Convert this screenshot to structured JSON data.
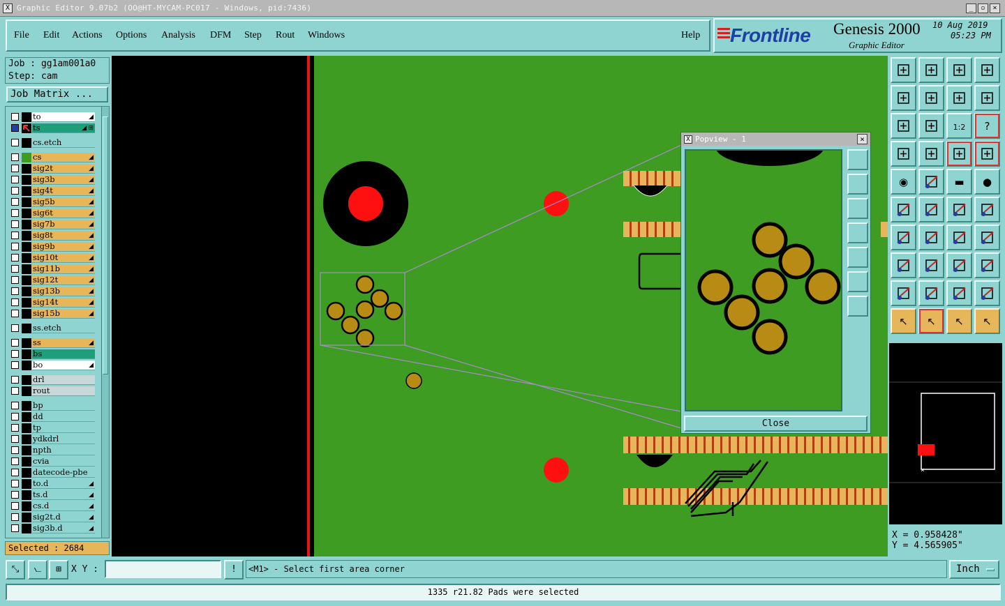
{
  "window": {
    "title": "Graphic Editor 9.07b2 (OO@HT-MYCAM-PC017 - Windows, pid:7436)",
    "title_icon": "X",
    "min_icon": "minimize-icon",
    "restore_icon": "restore-icon",
    "close_icon": "close-icon"
  },
  "menu": {
    "items": [
      "File",
      "Edit",
      "Actions",
      "Options",
      "Analysis",
      "DFM",
      "Step",
      "Rout",
      "Windows"
    ],
    "help": "Help"
  },
  "brand": {
    "logo": "Frontline",
    "product": "Genesis 2000",
    "subtitle": "Graphic Editor",
    "date": "10 Aug 2019",
    "time": "05:23 PM"
  },
  "job": {
    "job_line": "Job : gg1am001a0",
    "step_line": "Step: cam",
    "matrix_button": "Job Matrix ..."
  },
  "layers": [
    {
      "name": "to",
      "bg": "#ffffff",
      "color": "#000000",
      "mark": "◢"
    },
    {
      "name": "ts",
      "bg": "#1f9e7a",
      "color": "#000000",
      "mark": "◢ ⊞",
      "active": true
    },
    {
      "name": "cs.etch",
      "bg": "#8fd4d0",
      "color": "#000000",
      "mark": ""
    },
    {
      "name": "cs",
      "bg": "#e8b65a",
      "color": "#3f9c22",
      "mark": "◢"
    },
    {
      "name": "sig2t",
      "bg": "#e8b65a",
      "color": "#000000",
      "mark": "◢"
    },
    {
      "name": "sig3b",
      "bg": "#e8b65a",
      "color": "#000000",
      "mark": "◢"
    },
    {
      "name": "sig4t",
      "bg": "#e8b65a",
      "color": "#000000",
      "mark": "◢"
    },
    {
      "name": "sig5b",
      "bg": "#e8b65a",
      "color": "#000000",
      "mark": "◢"
    },
    {
      "name": "sig6t",
      "bg": "#e8b65a",
      "color": "#000000",
      "mark": "◢"
    },
    {
      "name": "sig7b",
      "bg": "#e8b65a",
      "color": "#000000",
      "mark": "◢"
    },
    {
      "name": "sig8t",
      "bg": "#e8b65a",
      "color": "#000000",
      "mark": "◢"
    },
    {
      "name": "sig9b",
      "bg": "#e8b65a",
      "color": "#000000",
      "mark": "◢"
    },
    {
      "name": "sig10t",
      "bg": "#e8b65a",
      "color": "#000000",
      "mark": "◢"
    },
    {
      "name": "sig11b",
      "bg": "#e8b65a",
      "color": "#000000",
      "mark": "◢"
    },
    {
      "name": "sig12t",
      "bg": "#e8b65a",
      "color": "#000000",
      "mark": "◢"
    },
    {
      "name": "sig13b",
      "bg": "#e8b65a",
      "color": "#000000",
      "mark": "◢"
    },
    {
      "name": "sig14t",
      "bg": "#e8b65a",
      "color": "#000000",
      "mark": "◢"
    },
    {
      "name": "sig15b",
      "bg": "#e8b65a",
      "color": "#000000",
      "mark": "◢"
    },
    {
      "name": "ss.etch",
      "bg": "#8fd4d0",
      "color": "#000000",
      "mark": ""
    },
    {
      "name": "ss",
      "bg": "#e8b65a",
      "color": "#000000",
      "mark": "◢"
    },
    {
      "name": "bs",
      "bg": "#1f9e7a",
      "color": "#000000",
      "mark": ""
    },
    {
      "name": "bo",
      "bg": "#ffffff",
      "color": "#000000",
      "mark": "◢"
    },
    {
      "name": "drl",
      "bg": "#c8d8d8",
      "color": "#000000",
      "mark": ""
    },
    {
      "name": "rout",
      "bg": "#c8d8d8",
      "color": "#000000",
      "mark": ""
    },
    {
      "name": "bp",
      "bg": "#8fd4d0",
      "color": "#000000",
      "mark": ""
    },
    {
      "name": "dd",
      "bg": "#8fd4d0",
      "color": "#000000",
      "mark": ""
    },
    {
      "name": "tp",
      "bg": "#8fd4d0",
      "color": "#000000",
      "mark": ""
    },
    {
      "name": "ydkdrl",
      "bg": "#8fd4d0",
      "color": "#000000",
      "mark": ""
    },
    {
      "name": "npth",
      "bg": "#8fd4d0",
      "color": "#000000",
      "mark": ""
    },
    {
      "name": "cvia",
      "bg": "#8fd4d0",
      "color": "#000000",
      "mark": ""
    },
    {
      "name": "datecode-pbe",
      "bg": "#8fd4d0",
      "color": "#000000",
      "mark": ""
    },
    {
      "name": "to.d",
      "bg": "#8fd4d0",
      "color": "#000000",
      "mark": "◢"
    },
    {
      "name": "ts.d",
      "bg": "#8fd4d0",
      "color": "#000000",
      "mark": "◢"
    },
    {
      "name": "cs.d",
      "bg": "#8fd4d0",
      "color": "#000000",
      "mark": "◢"
    },
    {
      "name": "sig2t.d",
      "bg": "#8fd4d0",
      "color": "#000000",
      "mark": "◢"
    },
    {
      "name": "sig3b.d",
      "bg": "#8fd4d0",
      "color": "#000000",
      "mark": "◢"
    }
  ],
  "selected": "Selected : 2684",
  "popview": {
    "title": "Popview - 1",
    "close": "Close",
    "close_icon": "close-icon"
  },
  "coords": {
    "x": "X = 0.958428\"",
    "y": "Y = 4.565905\""
  },
  "bottom": {
    "xy_label": "X Y :",
    "xy_value": "",
    "prompt": "<M1> - Select first area corner",
    "units": "Inch",
    "info_icon": "!"
  },
  "status": "1335 r21.82 Pads were selected",
  "colors": {
    "panel": "#8fd4d0",
    "board": "#3f9c22",
    "pad": "#b88c14",
    "drill": "#ff0000",
    "orange": "#e8b65a"
  }
}
